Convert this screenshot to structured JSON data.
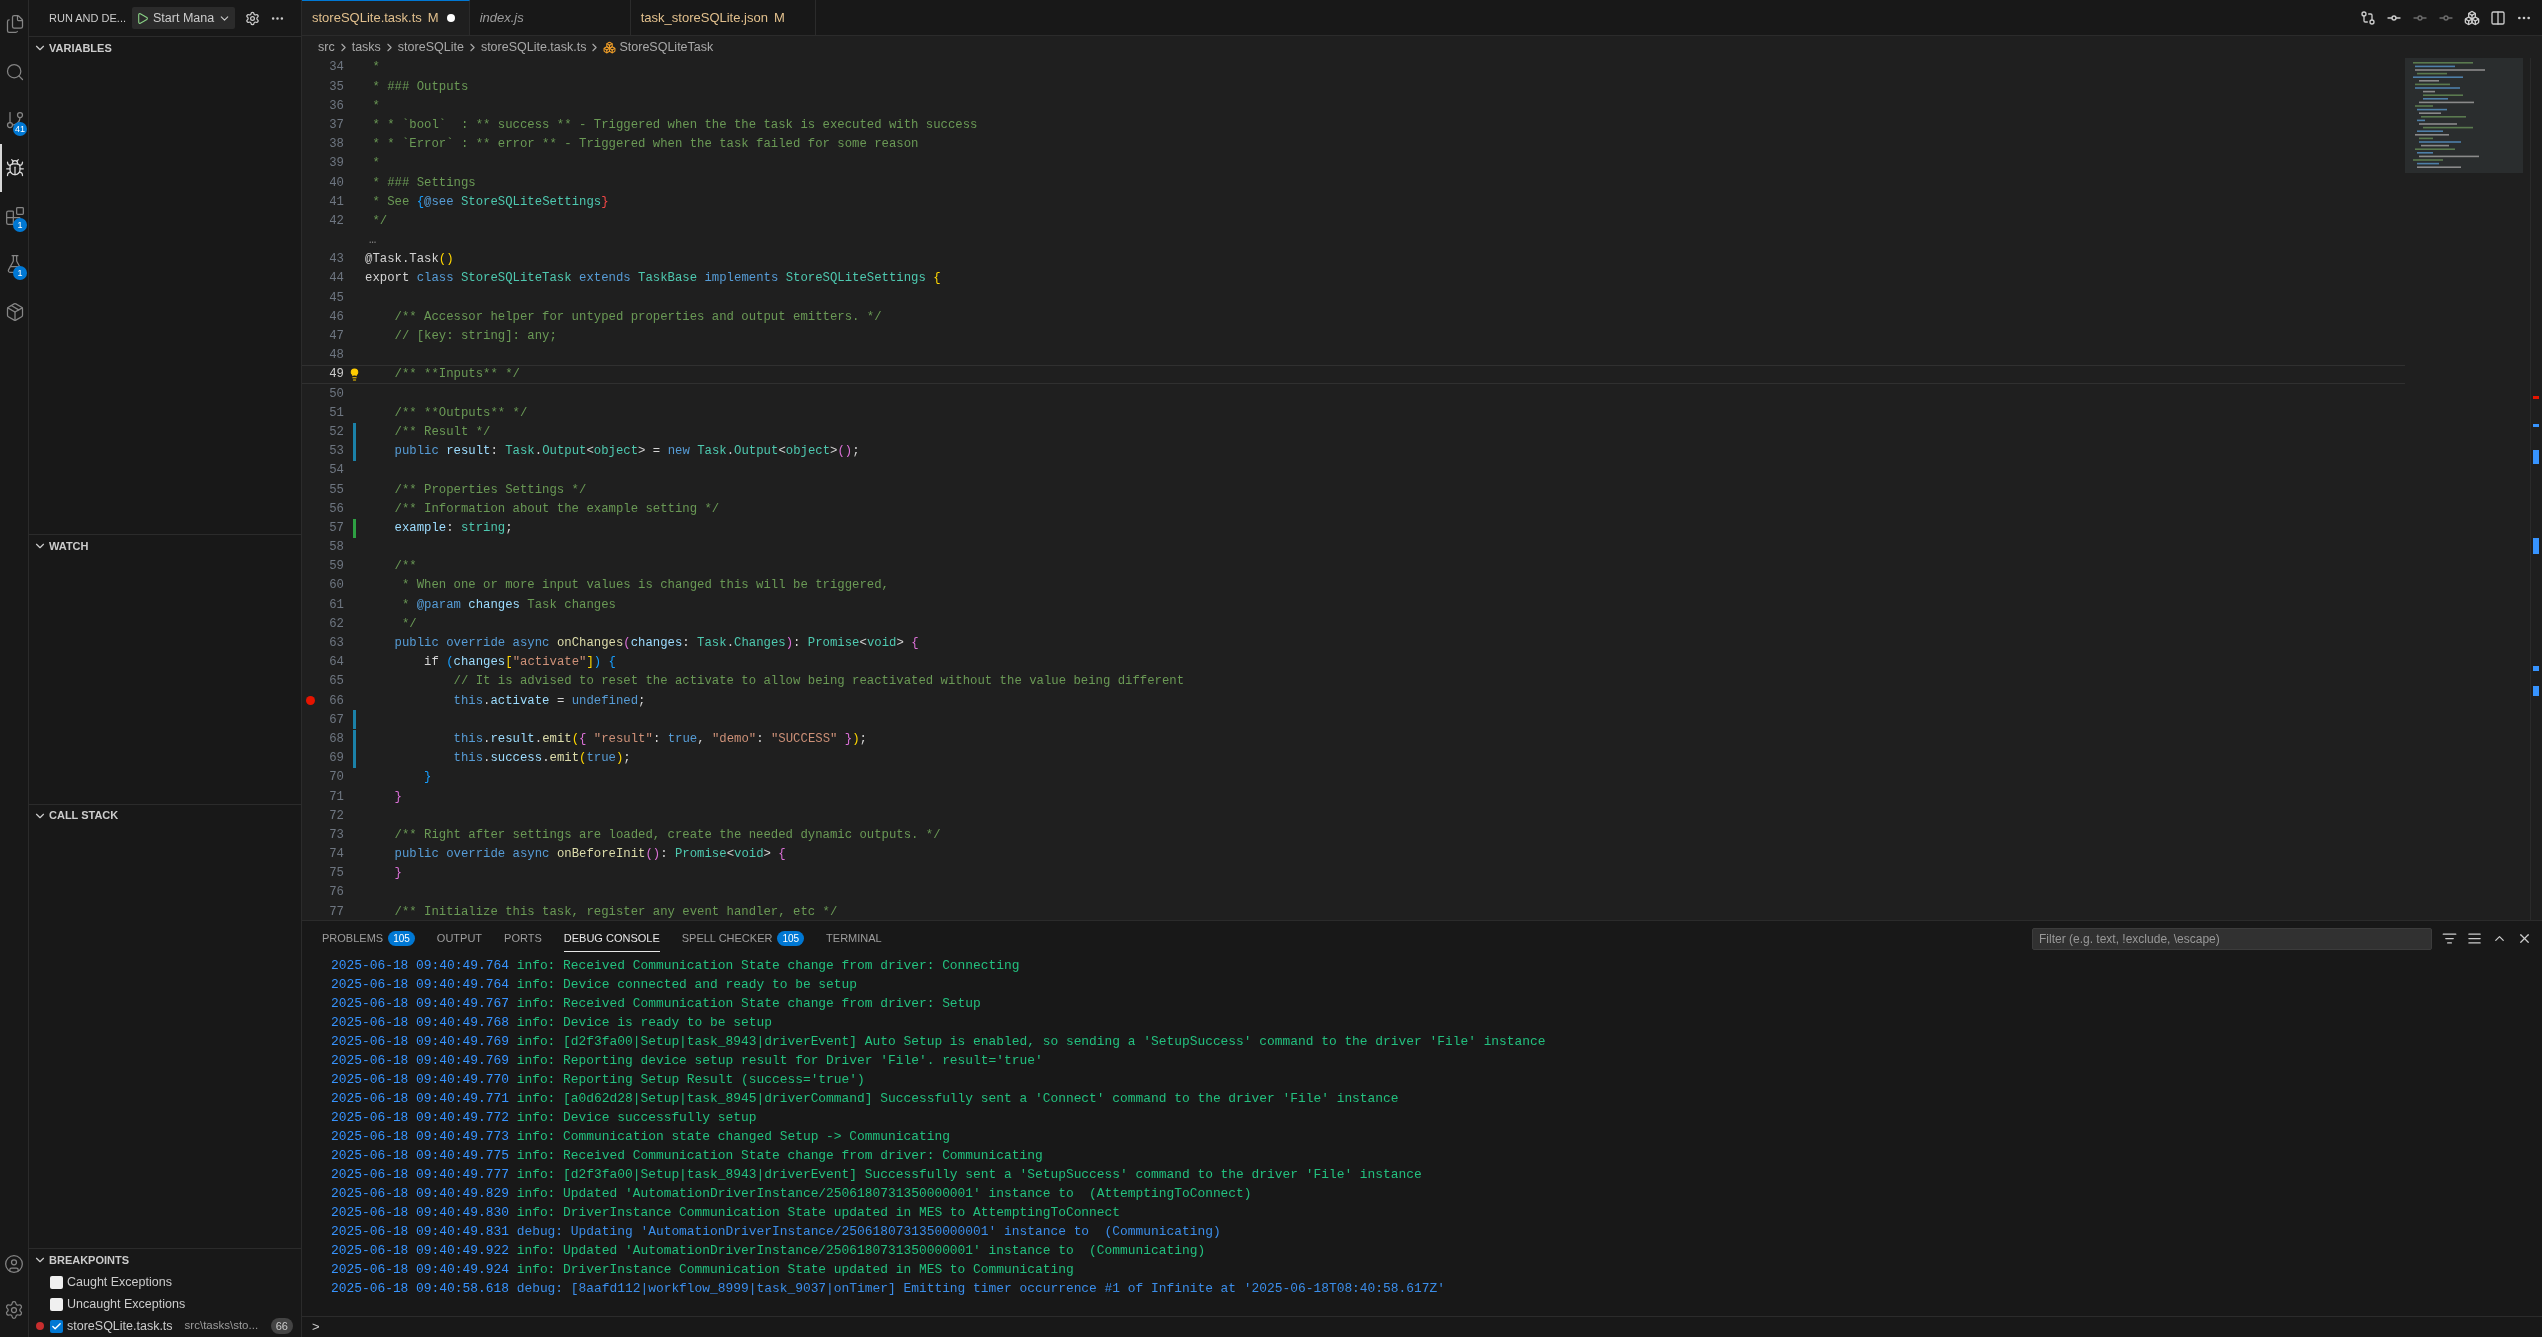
{
  "activity_bar": {
    "items": [
      {
        "kind": "files",
        "selected": false
      },
      {
        "kind": "search",
        "selected": false
      },
      {
        "kind": "source-control",
        "selected": false,
        "badge": "41"
      },
      {
        "kind": "run-debug",
        "selected": true
      },
      {
        "kind": "extensions",
        "selected": false,
        "badge": "1"
      },
      {
        "kind": "testing",
        "selected": false,
        "badge": "1"
      },
      {
        "kind": "remote",
        "selected": false
      }
    ],
    "bottom": [
      {
        "kind": "account"
      },
      {
        "kind": "settings"
      }
    ]
  },
  "sidebar": {
    "title": "RUN AND DE...",
    "launch_config": "Start Mana",
    "sections": [
      {
        "kind": "variables",
        "title": "VARIABLES",
        "expanded": true
      },
      {
        "kind": "watch",
        "title": "WATCH",
        "expanded": true
      },
      {
        "kind": "callstack",
        "title": "CALL STACK",
        "expanded": true
      },
      {
        "kind": "breakpoints",
        "title": "BREAKPOINTS",
        "expanded": true,
        "items": [
          {
            "label": "Caught Exceptions",
            "checked": false
          },
          {
            "label": "Uncaught Exceptions",
            "checked": false
          },
          {
            "label": "storeSQLite.task.ts",
            "path": "src\\tasks\\sto...",
            "line": "66",
            "checked": true,
            "dot": true
          }
        ]
      }
    ]
  },
  "tabs": [
    {
      "label": "storeSQLite.task.ts",
      "decoration": "M",
      "dirty": true,
      "preview": false,
      "selected": true
    },
    {
      "label": "index.js",
      "dirty": false,
      "preview": true,
      "selected": false
    },
    {
      "label": "task_storeSQLite.json",
      "decoration": "M",
      "dirty": false,
      "preview": false,
      "selected": false
    }
  ],
  "breadcrumb": [
    "src",
    "tasks",
    "storeSQLite",
    "storeSQLite.task.ts",
    "StoreSQLiteTask"
  ],
  "editor": {
    "rows": [
      {
        "kind": "code",
        "number": "34",
        "current": false,
        "tokens": [
          {
            "kind": "comment",
            "text": " *"
          }
        ]
      },
      {
        "kind": "code",
        "number": "35",
        "current": false,
        "tokens": [
          {
            "kind": "comment",
            "text": " * ### Outputs"
          }
        ]
      },
      {
        "kind": "code",
        "number": "36",
        "current": false,
        "tokens": [
          {
            "kind": "comment",
            "text": " *"
          }
        ]
      },
      {
        "kind": "code",
        "number": "37",
        "current": false,
        "tokens": [
          {
            "kind": "comment",
            "text": " * * `bool`  : ** success ** - Triggered when the the task is executed with success"
          }
        ]
      },
      {
        "kind": "code",
        "number": "38",
        "current": false,
        "tokens": [
          {
            "kind": "comment",
            "text": " * * `Error` : ** error ** - Triggered when the task failed for some reason"
          }
        ]
      },
      {
        "kind": "code",
        "number": "39",
        "current": false,
        "tokens": [
          {
            "kind": "comment",
            "text": " *"
          }
        ]
      },
      {
        "kind": "code",
        "number": "40",
        "current": false,
        "tokens": [
          {
            "kind": "comment",
            "text": " * ### Settings"
          }
        ]
      },
      {
        "kind": "code",
        "number": "41",
        "current": false,
        "tokens": [
          {
            "kind": "comment",
            "text": " * See "
          },
          {
            "kind": "bracket3",
            "text": "{"
          },
          {
            "kind": "keyword",
            "text": "@see "
          },
          {
            "kind": "type",
            "text": "StoreSQLiteSettings"
          },
          {
            "kind": "bracket_error",
            "text": "}"
          }
        ]
      },
      {
        "kind": "code",
        "number": "42",
        "current": false,
        "tokens": [
          {
            "kind": "comment",
            "text": " */"
          }
        ]
      },
      {
        "kind": "fold",
        "text": "…"
      },
      {
        "kind": "code",
        "number": "43",
        "current": false,
        "tokens": [
          {
            "kind": "plain",
            "text": "@Task.Task"
          },
          {
            "kind": "bracket1",
            "text": "()"
          }
        ]
      },
      {
        "kind": "code",
        "number": "44",
        "current": false,
        "tokens": [
          {
            "kind": "plain",
            "text": "export "
          },
          {
            "kind": "keyword",
            "text": "class "
          },
          {
            "kind": "type",
            "text": "StoreSQLiteTask "
          },
          {
            "kind": "keyword",
            "text": "extends "
          },
          {
            "kind": "type",
            "text": "TaskBase "
          },
          {
            "kind": "keyword",
            "text": "implements "
          },
          {
            "kind": "type",
            "text": "StoreSQLiteSettings "
          },
          {
            "kind": "bracket1",
            "text": "{"
          }
        ]
      },
      {
        "kind": "code",
        "number": "45",
        "current": false,
        "tokens": []
      },
      {
        "kind": "code",
        "number": "46",
        "current": false,
        "tokens": [
          {
            "kind": "comment",
            "text": "    /** Accessor helper for untyped properties and output emitters. */"
          }
        ]
      },
      {
        "kind": "code",
        "number": "47",
        "current": false,
        "tokens": [
          {
            "kind": "comment",
            "text": "    // [key: string]: any;"
          }
        ]
      },
      {
        "kind": "code",
        "number": "48",
        "current": false,
        "tokens": []
      },
      {
        "kind": "code",
        "number": "49",
        "current": true,
        "lightbulb": true,
        "tokens": [
          {
            "kind": "comment",
            "text": "    /** **Inputs** */"
          }
        ]
      },
      {
        "kind": "code",
        "number": "50",
        "current": false,
        "tokens": []
      },
      {
        "kind": "code",
        "number": "51",
        "current": false,
        "tokens": [
          {
            "kind": "comment",
            "text": "    /** **Outputs** */"
          }
        ]
      },
      {
        "kind": "code",
        "number": "52",
        "current": false,
        "modified": true,
        "tokens": [
          {
            "kind": "comment",
            "text": "    /** Result */"
          }
        ]
      },
      {
        "kind": "code",
        "number": "53",
        "current": false,
        "modified": true,
        "tokens": [
          {
            "kind": "keyword",
            "text": "    public "
          },
          {
            "kind": "var",
            "text": "result"
          },
          {
            "kind": "plain",
            "text": ": "
          },
          {
            "kind": "type",
            "text": "Task"
          },
          {
            "kind": "plain",
            "text": "."
          },
          {
            "kind": "type",
            "text": "Output"
          },
          {
            "kind": "plain",
            "text": "<"
          },
          {
            "kind": "type",
            "text": "object"
          },
          {
            "kind": "plain",
            "text": "> = "
          },
          {
            "kind": "keyword",
            "text": "new "
          },
          {
            "kind": "type",
            "text": "Task"
          },
          {
            "kind": "plain",
            "text": "."
          },
          {
            "kind": "type",
            "text": "Output"
          },
          {
            "kind": "plain",
            "text": "<"
          },
          {
            "kind": "type",
            "text": "object"
          },
          {
            "kind": "plain",
            "text": ">"
          },
          {
            "kind": "bracket2",
            "text": "()"
          },
          {
            "kind": "plain",
            "text": ";"
          }
        ]
      },
      {
        "kind": "code",
        "number": "54",
        "current": false,
        "tokens": []
      },
      {
        "kind": "code",
        "number": "55",
        "current": false,
        "tokens": [
          {
            "kind": "comment",
            "text": "    /** Properties Settings */"
          }
        ]
      },
      {
        "kind": "code",
        "number": "56",
        "current": false,
        "tokens": [
          {
            "kind": "comment",
            "text": "    /** Information about the example setting */"
          }
        ]
      },
      {
        "kind": "code",
        "number": "57",
        "current": false,
        "added": true,
        "tokens": [
          {
            "kind": "var",
            "text": "    example"
          },
          {
            "kind": "plain",
            "text": ": "
          },
          {
            "kind": "type",
            "text": "string"
          },
          {
            "kind": "plain",
            "text": ";"
          }
        ]
      },
      {
        "kind": "code",
        "number": "58",
        "current": false,
        "tokens": []
      },
      {
        "kind": "code",
        "number": "59",
        "current": false,
        "tokens": [
          {
            "kind": "comment",
            "text": "    /**"
          }
        ]
      },
      {
        "kind": "code",
        "number": "60",
        "current": false,
        "tokens": [
          {
            "kind": "comment",
            "text": "     * When one or more input values is changed this will be triggered,"
          }
        ]
      },
      {
        "kind": "code",
        "number": "61",
        "current": false,
        "tokens": [
          {
            "kind": "comment",
            "text": "     * "
          },
          {
            "kind": "keyword",
            "text": "@param "
          },
          {
            "kind": "var",
            "text": "changes "
          },
          {
            "kind": "comment",
            "text": "Task changes"
          }
        ]
      },
      {
        "kind": "code",
        "number": "62",
        "current": false,
        "tokens": [
          {
            "kind": "comment",
            "text": "     */"
          }
        ]
      },
      {
        "kind": "code",
        "number": "63",
        "current": false,
        "tokens": [
          {
            "kind": "keyword",
            "text": "    public override async "
          },
          {
            "kind": "func",
            "text": "onChanges"
          },
          {
            "kind": "bracket2",
            "text": "("
          },
          {
            "kind": "var",
            "text": "changes"
          },
          {
            "kind": "plain",
            "text": ": "
          },
          {
            "kind": "type",
            "text": "Task"
          },
          {
            "kind": "plain",
            "text": "."
          },
          {
            "kind": "type",
            "text": "Changes"
          },
          {
            "kind": "bracket2",
            "text": ")"
          },
          {
            "kind": "plain",
            "text": ": "
          },
          {
            "kind": "type",
            "text": "Promise"
          },
          {
            "kind": "plain",
            "text": "<"
          },
          {
            "kind": "type",
            "text": "void"
          },
          {
            "kind": "plain",
            "text": "> "
          },
          {
            "kind": "bracket2",
            "text": "{"
          }
        ]
      },
      {
        "kind": "code",
        "number": "64",
        "current": false,
        "tokens": [
          {
            "kind": "plain",
            "text": "        if "
          },
          {
            "kind": "bracket3",
            "text": "("
          },
          {
            "kind": "var",
            "text": "changes"
          },
          {
            "kind": "bracket1",
            "text": "["
          },
          {
            "kind": "string",
            "text": "\"activate\""
          },
          {
            "kind": "bracket1",
            "text": "]"
          },
          {
            "kind": "bracket3",
            "text": ") {"
          }
        ]
      },
      {
        "kind": "code",
        "number": "65",
        "current": false,
        "tokens": [
          {
            "kind": "comment",
            "text": "            // It is advised to reset the activate to allow being reactivated without the value being different"
          }
        ]
      },
      {
        "kind": "code",
        "number": "66",
        "current": false,
        "breakpoint": true,
        "tokens": [
          {
            "kind": "keyword",
            "text": "            this"
          },
          {
            "kind": "plain",
            "text": "."
          },
          {
            "kind": "var",
            "text": "activate"
          },
          {
            "kind": "plain",
            "text": " = "
          },
          {
            "kind": "keyword",
            "text": "undefined"
          },
          {
            "kind": "plain",
            "text": ";"
          }
        ]
      },
      {
        "kind": "code",
        "number": "67",
        "current": false,
        "modified": true,
        "tokens": []
      },
      {
        "kind": "code",
        "number": "68",
        "current": false,
        "modified": true,
        "tokens": [
          {
            "kind": "keyword",
            "text": "            this"
          },
          {
            "kind": "plain",
            "text": "."
          },
          {
            "kind": "var",
            "text": "result"
          },
          {
            "kind": "plain",
            "text": "."
          },
          {
            "kind": "func",
            "text": "emit"
          },
          {
            "kind": "bracket1",
            "text": "("
          },
          {
            "kind": "bracket2",
            "text": "{ "
          },
          {
            "kind": "string",
            "text": "\"result\""
          },
          {
            "kind": "plain",
            "text": ": "
          },
          {
            "kind": "keyword",
            "text": "true"
          },
          {
            "kind": "plain",
            "text": ", "
          },
          {
            "kind": "string",
            "text": "\"demo\""
          },
          {
            "kind": "plain",
            "text": ": "
          },
          {
            "kind": "string",
            "text": "\"SUCCESS\""
          },
          {
            "kind": "bracket2",
            "text": " }"
          },
          {
            "kind": "bracket1",
            "text": ")"
          },
          {
            "kind": "plain",
            "text": ";"
          }
        ]
      },
      {
        "kind": "code",
        "number": "69",
        "current": false,
        "modified": true,
        "tokens": [
          {
            "kind": "keyword",
            "text": "            this"
          },
          {
            "kind": "plain",
            "text": "."
          },
          {
            "kind": "var",
            "text": "success"
          },
          {
            "kind": "plain",
            "text": "."
          },
          {
            "kind": "func",
            "text": "emit"
          },
          {
            "kind": "bracket1",
            "text": "("
          },
          {
            "kind": "keyword",
            "text": "true"
          },
          {
            "kind": "bracket1",
            "text": ")"
          },
          {
            "kind": "plain",
            "text": ";"
          }
        ]
      },
      {
        "kind": "code",
        "number": "70",
        "current": false,
        "tokens": [
          {
            "kind": "bracket3",
            "text": "        }"
          }
        ]
      },
      {
        "kind": "code",
        "number": "71",
        "current": false,
        "tokens": [
          {
            "kind": "bracket2",
            "text": "    }"
          }
        ]
      },
      {
        "kind": "code",
        "number": "72",
        "current": false,
        "tokens": []
      },
      {
        "kind": "code",
        "number": "73",
        "current": false,
        "tokens": [
          {
            "kind": "comment",
            "text": "    /** Right after settings are loaded, create the needed dynamic outputs. */"
          }
        ]
      },
      {
        "kind": "code",
        "number": "74",
        "current": false,
        "tokens": [
          {
            "kind": "keyword",
            "text": "    public override async "
          },
          {
            "kind": "func",
            "text": "onBeforeInit"
          },
          {
            "kind": "bracket2",
            "text": "()"
          },
          {
            "kind": "plain",
            "text": ": "
          },
          {
            "kind": "type",
            "text": "Promise"
          },
          {
            "kind": "plain",
            "text": "<"
          },
          {
            "kind": "type",
            "text": "void"
          },
          {
            "kind": "plain",
            "text": "> "
          },
          {
            "kind": "bracket2",
            "text": "{"
          }
        ]
      },
      {
        "kind": "code",
        "number": "75",
        "current": false,
        "tokens": [
          {
            "kind": "bracket2",
            "text": "    }"
          }
        ]
      },
      {
        "kind": "code",
        "number": "76",
        "current": false,
        "tokens": []
      },
      {
        "kind": "code",
        "number": "77",
        "current": false,
        "tokens": [
          {
            "kind": "comment",
            "text": "    /** Initialize this task, register any event handler, etc */"
          }
        ]
      }
    ]
  },
  "panel": {
    "tabs": [
      {
        "label": "PROBLEMS",
        "badge": "105",
        "selected": false
      },
      {
        "label": "OUTPUT",
        "selected": false
      },
      {
        "label": "PORTS",
        "selected": false
      },
      {
        "label": "DEBUG CONSOLE",
        "selected": true
      },
      {
        "label": "SPELL CHECKER",
        "badge": "105",
        "selected": false
      },
      {
        "label": "TERMINAL",
        "selected": false
      }
    ],
    "filter": {
      "placeholder": "Filter (e.g. text, !exclude, \\escape)"
    },
    "prompt": ">",
    "lines": [
      {
        "time": "2025-06-18 09:40:49.764",
        "kind": "info",
        "message": "info: Received Communication State change from driver: Connecting"
      },
      {
        "time": "2025-06-18 09:40:49.764",
        "kind": "info",
        "message": "info: Device connected and ready to be setup"
      },
      {
        "time": "2025-06-18 09:40:49.767",
        "kind": "info",
        "message": "info: Received Communication State change from driver: Setup"
      },
      {
        "time": "2025-06-18 09:40:49.768",
        "kind": "info",
        "message": "info: Device is ready to be setup"
      },
      {
        "time": "2025-06-18 09:40:49.769",
        "kind": "info",
        "message": "info: [d2f3fa00|Setup|task_8943|driverEvent] Auto Setup is enabled, so sending a 'SetupSuccess' command to the driver 'File' instance"
      },
      {
        "time": "2025-06-18 09:40:49.769",
        "kind": "info",
        "message": "info: Reporting device setup result for Driver 'File'. result='true'"
      },
      {
        "time": "2025-06-18 09:40:49.770",
        "kind": "info",
        "message": "info: Reporting Setup Result (success='true')"
      },
      {
        "time": "2025-06-18 09:40:49.771",
        "kind": "info",
        "message": "info: [a0d62d28|Setup|task_8945|driverCommand] Successfully sent a 'Connect' command to the driver 'File' instance"
      },
      {
        "time": "2025-06-18 09:40:49.772",
        "kind": "info",
        "message": "info: Device successfully setup"
      },
      {
        "time": "2025-06-18 09:40:49.773",
        "kind": "info",
        "message": "info: Communication state changed Setup -> Communicating"
      },
      {
        "time": "2025-06-18 09:40:49.775",
        "kind": "info",
        "message": "info: Received Communication State change from driver: Communicating"
      },
      {
        "time": "2025-06-18 09:40:49.777",
        "kind": "info",
        "message": "info: [d2f3fa00|Setup|task_8943|driverEvent] Successfully sent a 'SetupSuccess' command to the driver 'File' instance"
      },
      {
        "time": "2025-06-18 09:40:49.829",
        "kind": "info",
        "message": "info: Updated 'AutomationDriverInstance/2506180731350000001' instance to  (AttemptingToConnect)"
      },
      {
        "time": "2025-06-18 09:40:49.830",
        "kind": "info",
        "message": "info: DriverInstance Communication State updated in MES to AttemptingToConnect"
      },
      {
        "time": "2025-06-18 09:40:49.831",
        "kind": "debug",
        "message": "debug: Updating 'AutomationDriverInstance/2506180731350000001' instance to  (Communicating)"
      },
      {
        "time": "2025-06-18 09:40:49.922",
        "kind": "info",
        "message": "info: Updated 'AutomationDriverInstance/2506180731350000001' instance to  (Communicating)"
      },
      {
        "time": "2025-06-18 09:40:49.924",
        "kind": "info",
        "message": "info: DriverInstance Communication State updated in MES to Communicating"
      },
      {
        "time": "2025-06-18 09:40:58.618",
        "kind": "debug",
        "message": "debug: [8aafd112|workflow_8999|task_9037|onTimer] Emitting timer occurrence #1 of Infinite at '2025-06-18T08:40:58.617Z'"
      }
    ]
  }
}
